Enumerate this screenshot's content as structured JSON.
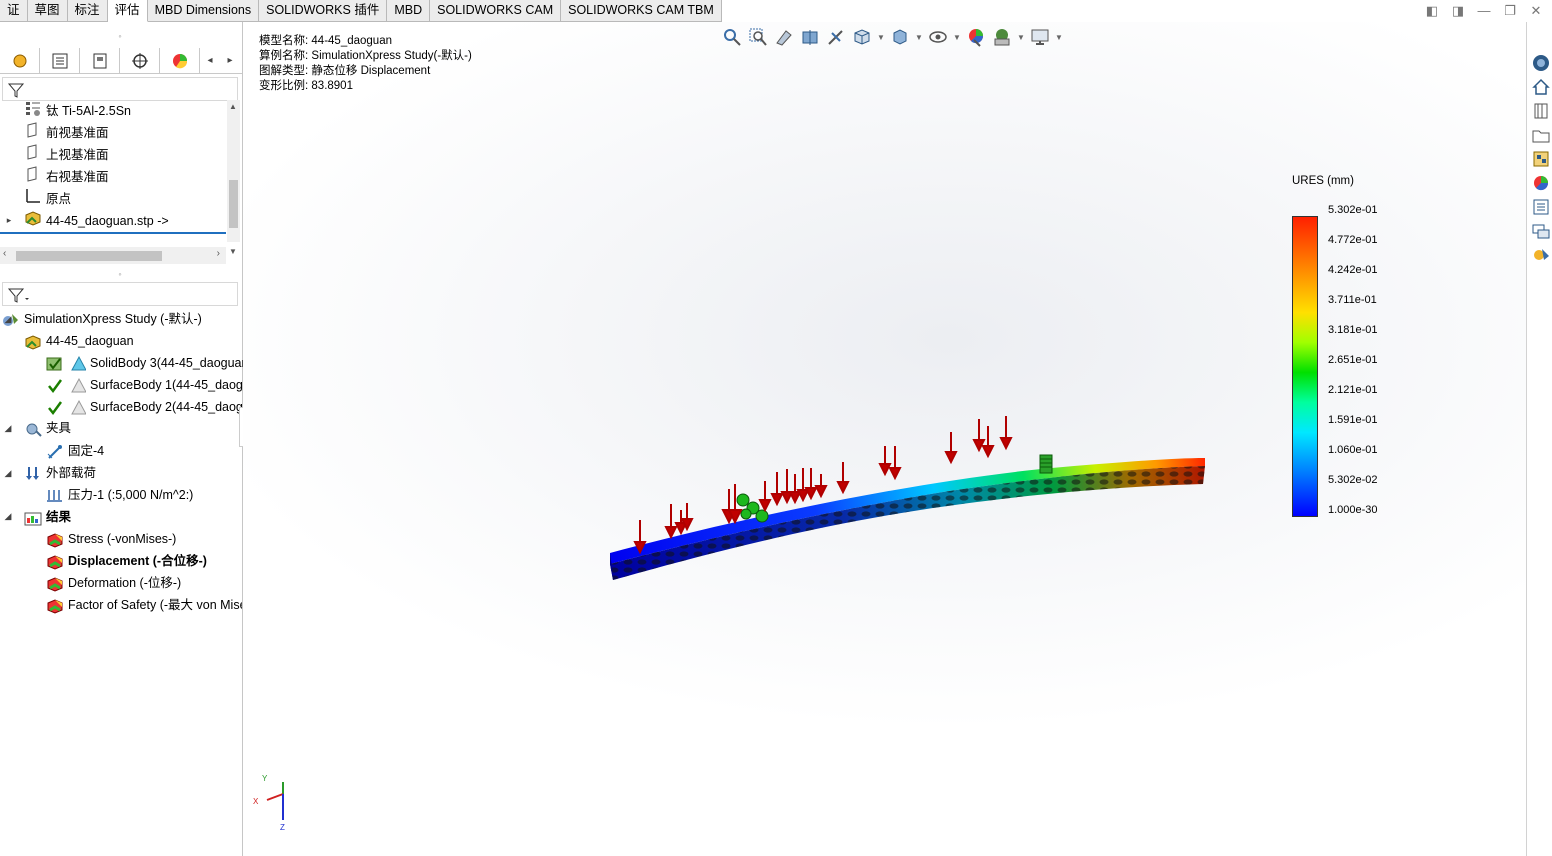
{
  "tabs": [
    {
      "label": "证",
      "active": false
    },
    {
      "label": "草图",
      "active": false
    },
    {
      "label": "标注",
      "active": false
    },
    {
      "label": "评估",
      "active": true
    },
    {
      "label": "MBD Dimensions",
      "active": false
    },
    {
      "label": "SOLIDWORKS 插件",
      "active": false
    },
    {
      "label": "MBD",
      "active": false
    },
    {
      "label": "SOLIDWORKS CAM",
      "active": false
    },
    {
      "label": "SOLIDWORKS CAM TBM",
      "active": false
    }
  ],
  "feature_tree": [
    {
      "label": "钛 Ti-5Al-2.5Sn",
      "icon": "material-icon"
    },
    {
      "label": "前视基准面",
      "icon": "plane-icon"
    },
    {
      "label": "上视基准面",
      "icon": "plane-icon"
    },
    {
      "label": "右视基准面",
      "icon": "plane-icon"
    },
    {
      "label": "原点",
      "icon": "origin-icon"
    },
    {
      "label": "44-45_daoguan.stp ->",
      "icon": "part-icon"
    }
  ],
  "sim_tree": {
    "study": "SimulationXpress Study (-默认-)",
    "part": "44-45_daoguan",
    "bodies": [
      "SolidBody 3(44-45_daoguan",
      "SurfaceBody 1(44-45_daogu",
      "SurfaceBody 2(44-45_daogu"
    ],
    "fixtures_label": "夹具",
    "fixture_item": "固定-4",
    "loads_label": "外部载荷",
    "load_item": "压力-1 (:5,000 N/m^2:)",
    "results_label": "结果",
    "results": [
      {
        "label": "Stress (-vonMises-)",
        "active": false
      },
      {
        "label": "Displacement (-合位移-)",
        "active": true
      },
      {
        "label": "Deformation (-位移-)",
        "active": false
      },
      {
        "label": "Factor of Safety (-最大 von Mise",
        "active": false
      }
    ]
  },
  "info": {
    "model_key": "模型名称:",
    "model_value": "44-45_daoguan",
    "study_key": "算例名称:",
    "study_value": "SimulationXpress Study(-默认-)",
    "plot_key": "图解类型:",
    "plot_value": "静态位移 Displacement",
    "scale_key": "变形比例:",
    "scale_value": "83.8901"
  },
  "legend": {
    "title": "URES (mm)",
    "labels": [
      "5.302e-01",
      "4.772e-01",
      "4.242e-01",
      "3.711e-01",
      "3.181e-01",
      "2.651e-01",
      "2.121e-01",
      "1.591e-01",
      "1.060e-01",
      "5.302e-02",
      "1.000e-30"
    ]
  },
  "triad": {
    "x": "X",
    "y": "Y",
    "z": "Z"
  }
}
